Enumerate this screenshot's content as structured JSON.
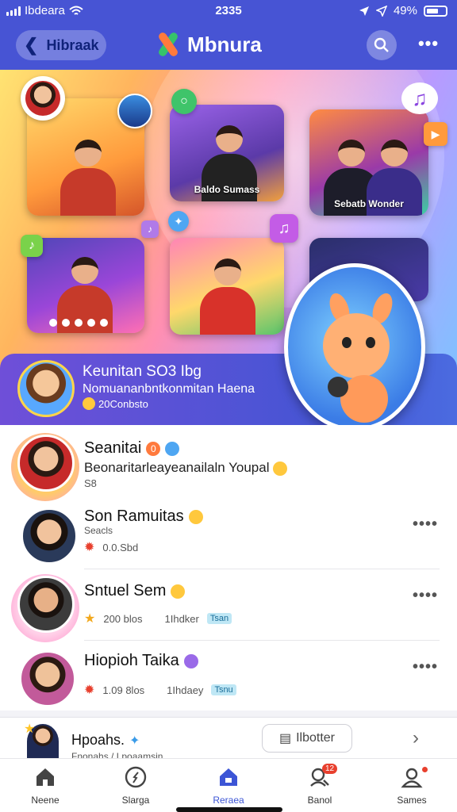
{
  "status_bar": {
    "carrier": "Ibdeara",
    "time": "2335",
    "battery": "49%"
  },
  "header": {
    "back_label": "Hibraak",
    "app_title": "Mbnura"
  },
  "hero": {
    "tiles": [
      {
        "caption": ""
      },
      {
        "caption": "Baldo Sumass"
      },
      {
        "caption": "Sebatb Wonder"
      },
      {
        "caption": ""
      },
      {
        "caption": ""
      },
      {
        "caption": ""
      }
    ],
    "banner": {
      "title": "Keunitan SO3 Ibg",
      "subtitle": "Nomuananbntkonmitan Haena",
      "meta": "20Conbsto"
    }
  },
  "list": {
    "items": [
      {
        "name": "Seanitai",
        "name_badge": "0",
        "subtitle": "Beonaritarleayeanailaln Youpal",
        "meta": "S8",
        "meta2": "",
        "tag": ""
      },
      {
        "name": "Son Ramuitas",
        "subtitle": "",
        "meta_top": "Seacls",
        "meta": "0.0.Sbd",
        "meta2": "",
        "tag": ""
      },
      {
        "name": "Sntuel Sem",
        "subtitle": "",
        "meta": "200 blos",
        "meta2": "1Ihdker",
        "tag": "Tsan"
      },
      {
        "name": "Hiopioh Taika",
        "subtitle": "",
        "meta": "1.09 8los",
        "meta2": "1Ihdaey",
        "tag": "Tsnu"
      }
    ]
  },
  "mini_player": {
    "title": "Hpoahs.",
    "subtitle": "Fnonahs / Lpoaamsin",
    "action_label": "Ilbotter"
  },
  "tabs": [
    {
      "label": "Neene",
      "icon": "home-outline-icon",
      "badge": ""
    },
    {
      "label": "Slarga",
      "icon": "compass-icon",
      "badge": ""
    },
    {
      "label": "Reraea",
      "icon": "home-filled-icon",
      "badge": ""
    },
    {
      "label": "Banol",
      "icon": "search-user-icon",
      "badge": "12"
    },
    {
      "label": "Sames",
      "icon": "profile-icon",
      "badge": ""
    }
  ],
  "colors": {
    "brand": "#4754d4",
    "accent": "#3c55d6",
    "alert": "#e8402e"
  }
}
